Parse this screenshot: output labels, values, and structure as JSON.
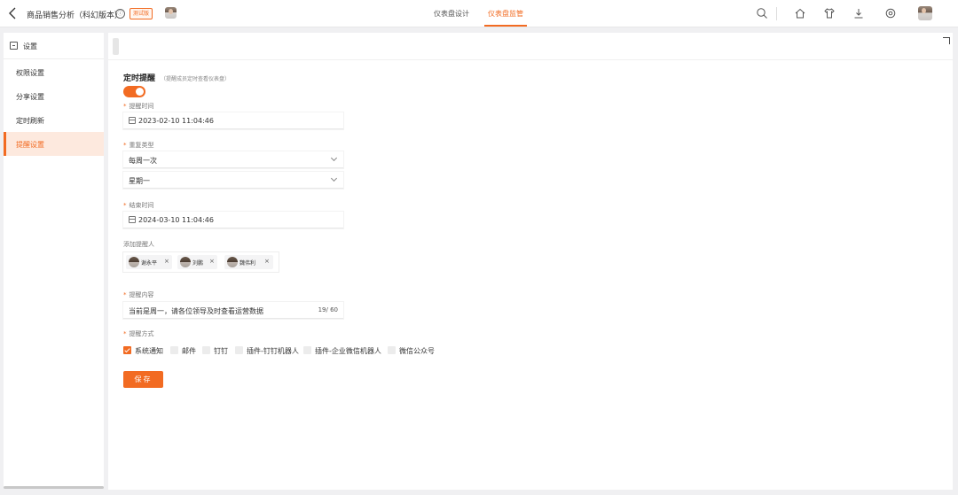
{
  "header": {
    "title": "商品销售分析（科幻版本）",
    "info_glyph": "ⓘ",
    "badge": "测试版",
    "tabs": [
      {
        "label": "仪表盘设计",
        "active": false
      },
      {
        "label": "仪表盘监管",
        "active": true
      }
    ],
    "accent_color": "#f26b22",
    "right_icons": [
      "search-icon",
      "home-icon",
      "shirt-icon",
      "download-icon",
      "settings-icon",
      "user-avatar"
    ]
  },
  "sidebar": {
    "title": "设置",
    "items": [
      {
        "label": "权限设置",
        "active": false
      },
      {
        "label": "分享设置",
        "active": false
      },
      {
        "label": "定时刷新",
        "active": false
      },
      {
        "label": "提醒设置",
        "active": true
      }
    ]
  },
  "form": {
    "section_title": "定时提醒",
    "section_subtitle": "（提醒成员定时查看仪表盘）",
    "enabled": true,
    "required_mark": "*",
    "remind_time": {
      "label": "提醒时间",
      "value": "2023-02-10 11:04:46"
    },
    "repeat_type": {
      "label": "重复类型",
      "value": "每周一次",
      "weekday": "星期一"
    },
    "end_time": {
      "label": "结束时间",
      "value": "2024-03-10 11:04:46"
    },
    "recipients": {
      "label": "添加提醒人",
      "people": [
        {
          "name": "谢永平",
          "remove": "×"
        },
        {
          "name": "刘鹏",
          "remove": "×"
        },
        {
          "name": "魏伟利",
          "remove": "×"
        }
      ]
    },
    "content": {
      "label": "提醒内容",
      "value": "当前是周一，请各位领导及时查看运营数据",
      "counter": "19/ 60"
    },
    "methods": {
      "label": "提醒方式",
      "options": [
        {
          "label": "系统通知",
          "checked": true
        },
        {
          "label": "邮件",
          "checked": false
        },
        {
          "label": "钉钉",
          "checked": false
        },
        {
          "label": "插件-钉钉机器人",
          "checked": false
        },
        {
          "label": "插件-企业微信机器人",
          "checked": false
        },
        {
          "label": "微信公众号",
          "checked": false
        }
      ]
    },
    "save_label": "保存"
  }
}
